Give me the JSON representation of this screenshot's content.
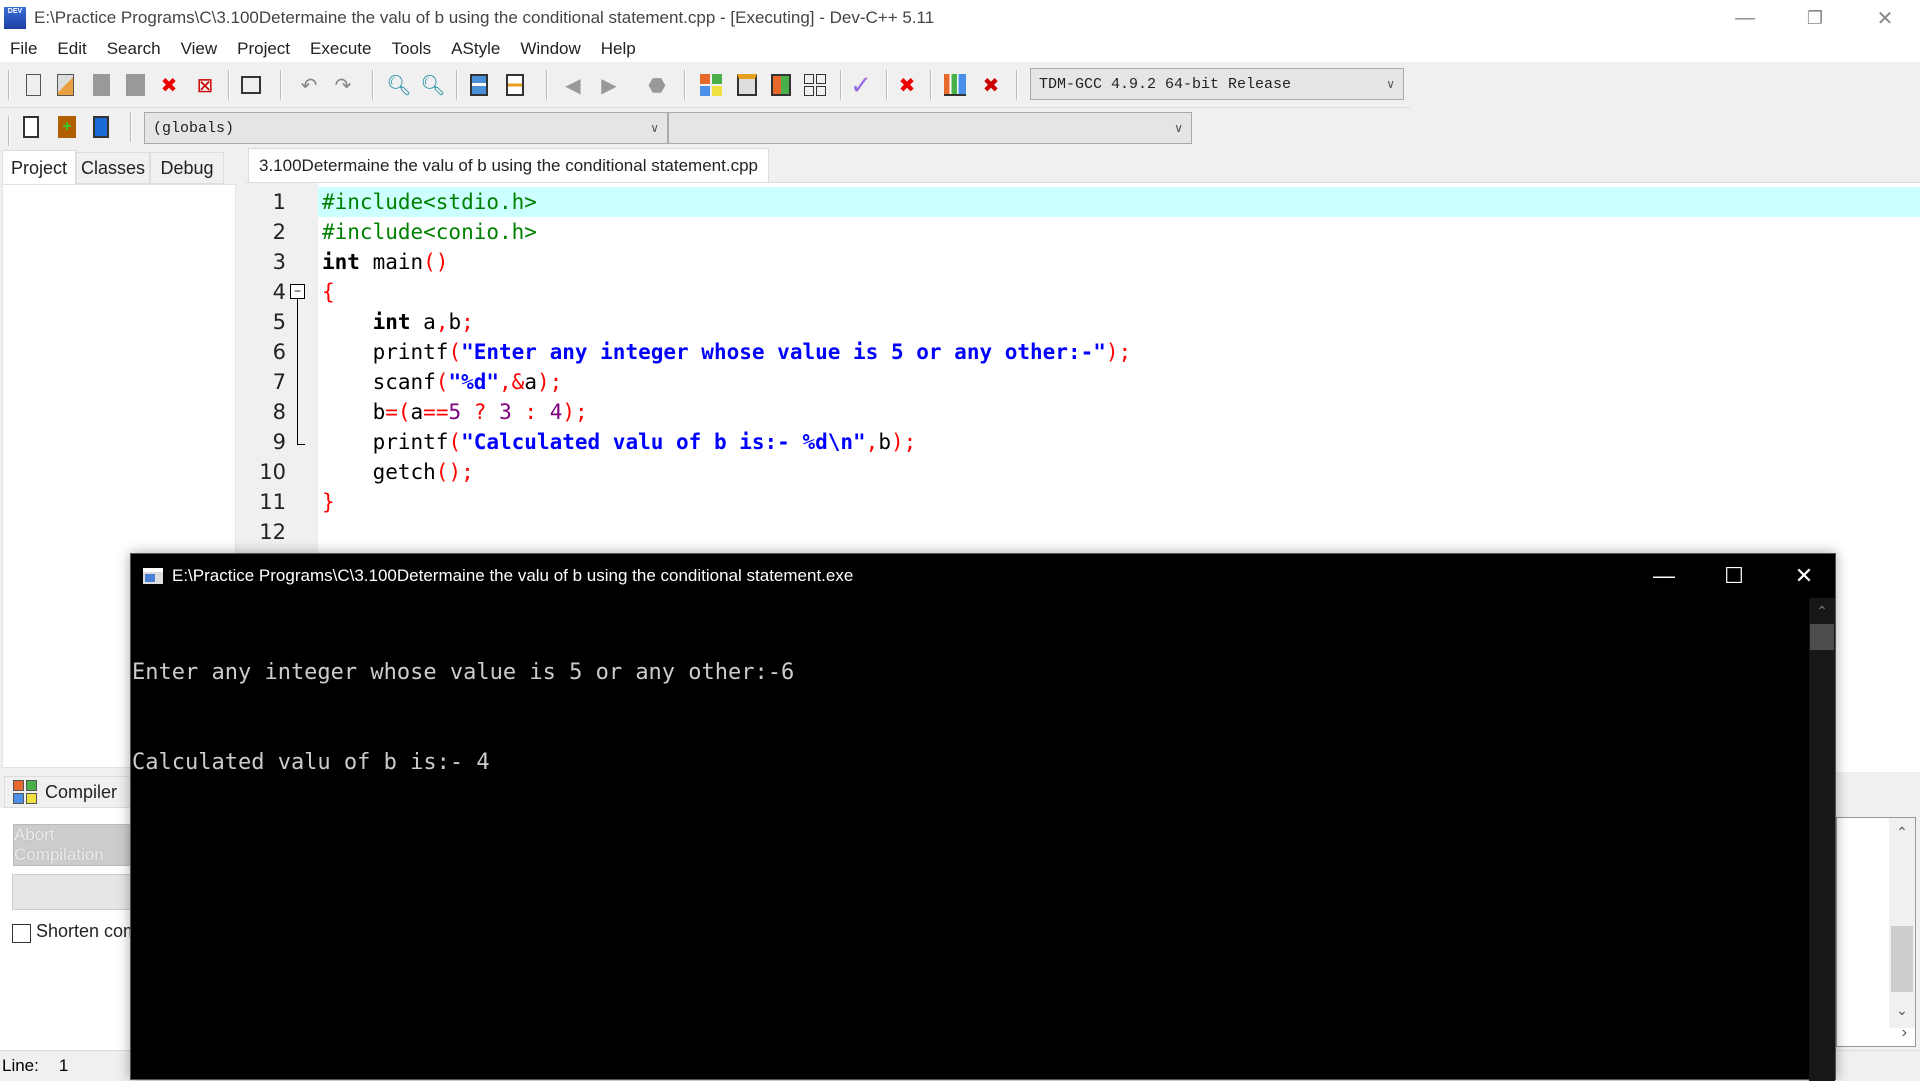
{
  "window": {
    "title": "E:\\Practice Programs\\C\\3.100Determaine the valu of b using the conditional statement.cpp - [Executing] - Dev-C++ 5.11",
    "app_icon": "DEV",
    "controls": {
      "minimize": "—",
      "restore": "❐",
      "close": "✕"
    }
  },
  "menu": [
    "File",
    "Edit",
    "Search",
    "View",
    "Project",
    "Execute",
    "Tools",
    "AStyle",
    "Window",
    "Help"
  ],
  "toolbar": {
    "compiler_select": "TDM-GCC 4.9.2 64-bit Release",
    "globals_select": "(globals)",
    "members_select": ""
  },
  "left_tabs": [
    "Project",
    "Classes",
    "Debug"
  ],
  "editor": {
    "tab_label": "3.100Determaine the valu of b using the conditional statement.cpp",
    "lines": [
      {
        "n": "1",
        "tokens": [
          {
            "t": "pp",
            "v": "#include<stdio.h>"
          }
        ]
      },
      {
        "n": "2",
        "tokens": [
          {
            "t": "pp",
            "v": "#include<conio.h>"
          }
        ]
      },
      {
        "n": "3",
        "tokens": [
          {
            "t": "kw",
            "v": "int"
          },
          {
            "t": "id",
            "v": " main"
          },
          {
            "t": "sym",
            "v": "()"
          }
        ]
      },
      {
        "n": "4",
        "tokens": [
          {
            "t": "sym",
            "v": "{"
          }
        ]
      },
      {
        "n": "5",
        "tokens": [
          {
            "t": "id",
            "v": "    "
          },
          {
            "t": "kw",
            "v": "int"
          },
          {
            "t": "id",
            "v": " a"
          },
          {
            "t": "sym",
            "v": ","
          },
          {
            "t": "id",
            "v": "b"
          },
          {
            "t": "sym",
            "v": ";"
          }
        ]
      },
      {
        "n": "6",
        "tokens": [
          {
            "t": "id",
            "v": "    printf"
          },
          {
            "t": "sym",
            "v": "("
          },
          {
            "t": "str",
            "v": "\"Enter any integer whose value is 5 or any other:-\""
          },
          {
            "t": "sym",
            "v": ");"
          }
        ]
      },
      {
        "n": "7",
        "tokens": [
          {
            "t": "id",
            "v": "    scanf"
          },
          {
            "t": "sym",
            "v": "("
          },
          {
            "t": "str",
            "v": "\"%d\""
          },
          {
            "t": "sym",
            "v": ",&"
          },
          {
            "t": "id",
            "v": "a"
          },
          {
            "t": "sym",
            "v": ");"
          }
        ]
      },
      {
        "n": "8",
        "tokens": [
          {
            "t": "id",
            "v": "    b"
          },
          {
            "t": "sym",
            "v": "=("
          },
          {
            "t": "id",
            "v": "a"
          },
          {
            "t": "sym",
            "v": "=="
          },
          {
            "t": "num",
            "v": "5"
          },
          {
            "t": "id",
            "v": " "
          },
          {
            "t": "sym",
            "v": "?"
          },
          {
            "t": "id",
            "v": " "
          },
          {
            "t": "num",
            "v": "3"
          },
          {
            "t": "id",
            "v": " "
          },
          {
            "t": "sym",
            "v": ":"
          },
          {
            "t": "id",
            "v": " "
          },
          {
            "t": "num",
            "v": "4"
          },
          {
            "t": "sym",
            "v": ");"
          }
        ]
      },
      {
        "n": "9",
        "tokens": [
          {
            "t": "id",
            "v": "    printf"
          },
          {
            "t": "sym",
            "v": "("
          },
          {
            "t": "str",
            "v": "\"Calculated valu of b is:- %d\\n\""
          },
          {
            "t": "sym",
            "v": ","
          },
          {
            "t": "id",
            "v": "b"
          },
          {
            "t": "sym",
            "v": ");"
          }
        ]
      },
      {
        "n": "10",
        "tokens": [
          {
            "t": "id",
            "v": "    getch"
          },
          {
            "t": "sym",
            "v": "();"
          }
        ]
      },
      {
        "n": "11",
        "tokens": [
          {
            "t": "sym",
            "v": "}"
          }
        ]
      },
      {
        "n": "12",
        "tokens": []
      }
    ],
    "fold_icon": "⊟"
  },
  "compiler_panel": {
    "tab_label": "Compiler",
    "abort_button": "Abort Compilation",
    "shorten_checkbox": "Shorten compiler paths"
  },
  "statusbar": {
    "line_label": "Line:",
    "line_value": "1"
  },
  "console": {
    "title": "E:\\Practice Programs\\C\\3.100Determaine the valu of b using the conditional statement.exe",
    "output": [
      "Enter any integer whose value is 5 or any other:-6",
      "Calculated valu of b is:- 4"
    ],
    "controls": {
      "minimize": "—",
      "maximize": "☐",
      "close": "✕"
    }
  }
}
